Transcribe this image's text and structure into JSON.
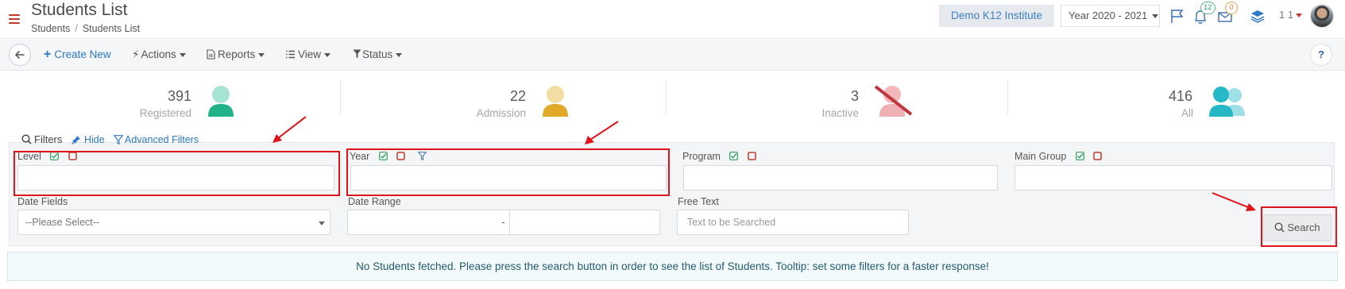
{
  "header": {
    "title": "Students List",
    "breadcrumb": [
      "Students",
      "Students List"
    ],
    "institute": "Demo K12 Institute",
    "year": "Year 2020 - 2021",
    "notifications_count": "12",
    "messages_count": "0",
    "user_label": "1 1"
  },
  "toolbar": {
    "create_new": "Create New",
    "actions": "Actions",
    "reports": "Reports",
    "view": "View",
    "status": "Status",
    "help": "?"
  },
  "stats": [
    {
      "value": "391",
      "label": "Registered",
      "color": "#21b28a",
      "head": "#a7e3d2"
    },
    {
      "value": "22",
      "label": "Admission",
      "color": "#e0a92a",
      "head": "#f2dea3"
    },
    {
      "value": "3",
      "label": "Inactive",
      "color": "#efb0b4",
      "head": "#f3b8bb",
      "slash": "#c0363f"
    },
    {
      "value": "416",
      "label": "All",
      "color": "#26b8c4",
      "head": "#9fe0e6"
    }
  ],
  "filters": {
    "filters_label": "Filters",
    "hide_label": "Hide",
    "advanced_label": "Advanced Filters",
    "level_label": "Level",
    "year_label": "Year",
    "program_label": "Program",
    "main_group_label": "Main Group",
    "date_fields_label": "Date Fields",
    "date_fields_value": "--Please Select--",
    "date_range_label": "Date Range",
    "date_range_sep": "-",
    "free_text_label": "Free Text",
    "free_text_placeholder": "Text to be Searched",
    "search_label": "Search"
  },
  "info_message": "No Students fetched. Please press the search button in order to see the list of Students. Tooltip: set some filters for a faster response!",
  "colors": {
    "accent_blue": "#2b78c5",
    "annotation_red": "#e0121a",
    "check_green": "#2f9e63",
    "uncheck_red": "#c0392b"
  }
}
